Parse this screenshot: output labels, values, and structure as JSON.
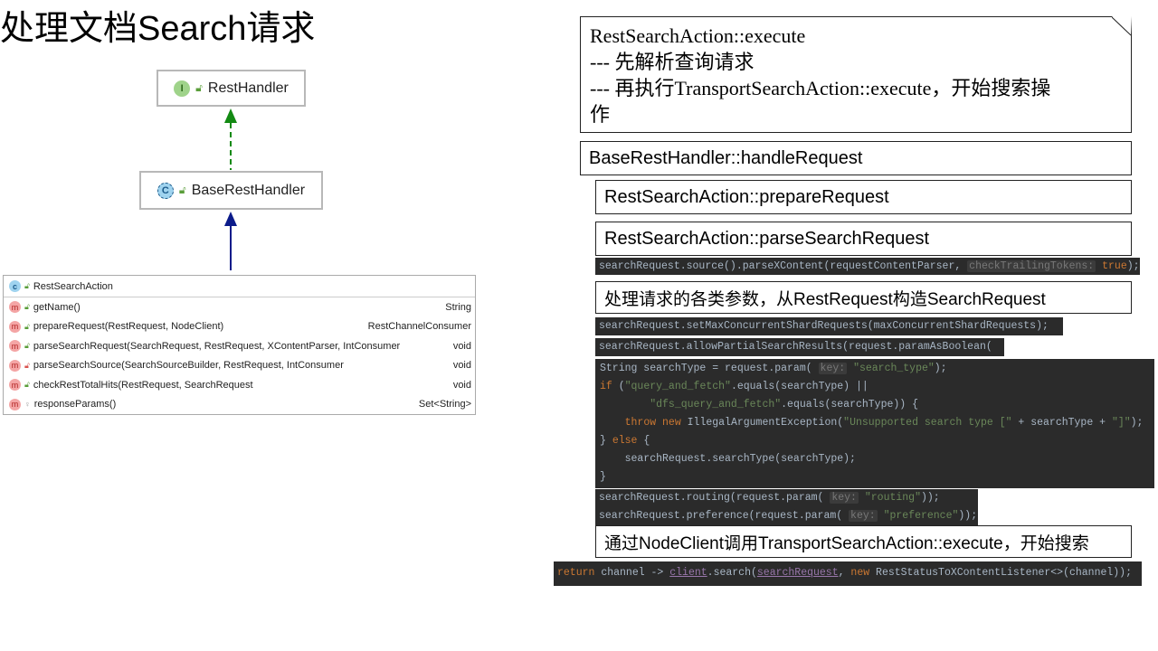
{
  "title": "处理文档Search请求",
  "uml": {
    "rest_handler": {
      "badge": "I",
      "name": "RestHandler"
    },
    "base_rest_handler": {
      "badge": "C",
      "name": "BaseRestHandler"
    },
    "rest_search_action": {
      "badge": "c",
      "name": "RestSearchAction",
      "methods": [
        {
          "name": "getName()",
          "type": "String",
          "access": "public"
        },
        {
          "name": "prepareRequest(RestRequest, NodeClient)",
          "type": "RestChannelConsumer",
          "access": "public"
        },
        {
          "name": "parseSearchRequest(SearchRequest, RestRequest, XContentParser, IntConsumer",
          "type": "void",
          "access": "public"
        },
        {
          "name": "parseSearchSource(SearchSourceBuilder, RestRequest, IntConsumer",
          "type": "void",
          "access": "private"
        },
        {
          "name": "checkRestTotalHits(RestRequest, SearchRequest",
          "type": "void",
          "access": "public"
        },
        {
          "name": "responseParams()",
          "type": "Set<String>",
          "access": "protected"
        }
      ]
    }
  },
  "note": {
    "lines": [
      "RestSearchAction::execute",
      "--- 先解析查询请求",
      "--- 再执行TransportSearchAction::execute，开始搜索操",
      "作"
    ]
  },
  "steps": {
    "handle_request": "BaseRestHandler::handleRequest",
    "prepare_request": "RestSearchAction::prepareRequest",
    "parse_search_request": "RestSearchAction::parseSearchRequest",
    "process_params": "处理请求的各类参数，从RestRequest构造SearchRequest",
    "call_client": "通过NodeClient调用TransportSearchAction::execute，开始搜索"
  },
  "code": {
    "parse_xcontent": [
      [
        [
          "searchRequest.source().parseXContent(requestContentParser, ",
          ""
        ],
        [
          "checkTrailingTokens:",
          "h"
        ],
        [
          " ",
          ""
        ],
        [
          "true",
          "t"
        ],
        [
          ");",
          ""
        ]
      ]
    ],
    "shard_requests": [
      [
        [
          "searchRequest.setMaxConcurrentShardRequests(maxConcurrentShardRequests);",
          ""
        ]
      ]
    ],
    "partial_results": [
      [
        [
          "searchRequest.allowPartialSearchResults(request.paramAsBoolean(",
          ""
        ]
      ]
    ],
    "search_type": [
      [
        [
          "String searchType = request.param( ",
          ""
        ],
        [
          "key:",
          "h"
        ],
        [
          " ",
          ""
        ],
        [
          "\"search_type\"",
          "s"
        ],
        [
          ");",
          ""
        ]
      ],
      [
        [
          "if",
          "k"
        ],
        [
          " (",
          ""
        ],
        [
          "\"query_and_fetch\"",
          "s"
        ],
        [
          ".equals(searchType) ||",
          ""
        ]
      ],
      [
        [
          "        ",
          ""
        ],
        [
          "\"dfs_query_and_fetch\"",
          "s"
        ],
        [
          ".equals(searchType)) {",
          ""
        ]
      ],
      [
        [
          "    ",
          ""
        ],
        [
          "throw new",
          "k"
        ],
        [
          " IllegalArgumentException(",
          ""
        ],
        [
          "\"Unsupported search type [\"",
          "s"
        ],
        [
          " + searchType + ",
          ""
        ],
        [
          "\"]\"",
          "s"
        ],
        [
          ");",
          ""
        ]
      ],
      [
        [
          "} ",
          ""
        ],
        [
          "else",
          "k"
        ],
        [
          " {",
          ""
        ]
      ],
      [
        [
          "    searchRequest.searchType(searchType);",
          ""
        ]
      ],
      [
        [
          "}",
          ""
        ]
      ]
    ],
    "routing": [
      [
        [
          "searchRequest.routing(request.param( ",
          ""
        ],
        [
          "key:",
          "h"
        ],
        [
          " ",
          ""
        ],
        [
          "\"routing\"",
          "s"
        ],
        [
          "));",
          ""
        ]
      ],
      [
        [
          "searchRequest.preference(request.param( ",
          ""
        ],
        [
          "key:",
          "h"
        ],
        [
          " ",
          ""
        ],
        [
          "\"preference\"",
          "s"
        ],
        [
          "));",
          ""
        ]
      ]
    ],
    "return_stmt": [
      [
        [
          "return",
          "k"
        ],
        [
          " channel -> ",
          ""
        ],
        [
          "client",
          "p"
        ],
        [
          ".search(",
          ""
        ],
        [
          "searchRequest",
          "p"
        ],
        [
          ", ",
          ""
        ],
        [
          "new",
          "k"
        ],
        [
          " RestStatusToXContentListener<>(channel));",
          ""
        ]
      ]
    ]
  },
  "colors": {
    "code_bg": "#2b2b2b",
    "keyword": "#cc7832",
    "string": "#6a8759",
    "arrow_impl": "#138a13",
    "arrow_ext": "#0b1b8a"
  }
}
